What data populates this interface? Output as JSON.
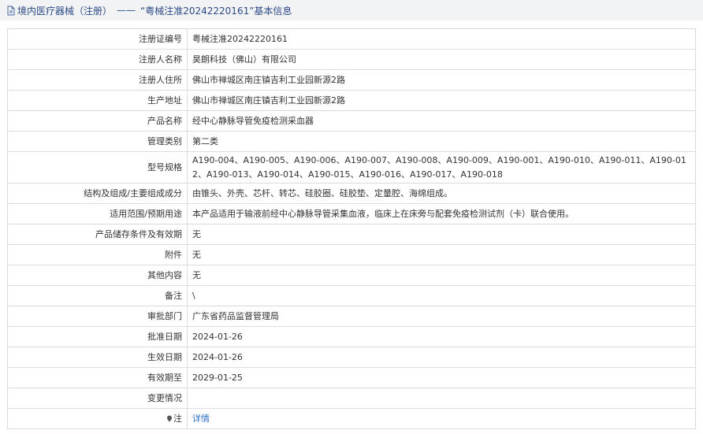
{
  "header": {
    "category": "境内医疗器械（注册）",
    "separator": "——",
    "record_title": "“粤械注准20242220161”基本信息"
  },
  "rows": [
    {
      "label": "注册证编号",
      "value": "粤械注准20242220161"
    },
    {
      "label": "注册人名称",
      "value": "昊朗科技（佛山）有限公司"
    },
    {
      "label": "注册人住所",
      "value": "佛山市禅城区南庄镇吉利工业园新源2路"
    },
    {
      "label": "生产地址",
      "value": "佛山市禅城区南庄镇吉利工业园新源2路"
    },
    {
      "label": "产品名称",
      "value": "经中心静脉导管免疫检测采血器"
    },
    {
      "label": "管理类别",
      "value": "第二类"
    },
    {
      "label": "型号规格",
      "value": "A190-004、A190-005、A190-006、A190-007、A190-008、A190-009、A190-001、A190-010、A190-011、A190-012、A190-013、A190-014、A190-015、A190-016、A190-017、A190-018"
    },
    {
      "label": "结构及组成/主要组成成分",
      "value": "由锥头、外壳、芯杆、转芯、硅胶圈、硅胶垫、定量腔、海绵组成。"
    },
    {
      "label": "适用范围/预期用途",
      "value": "本产品适用于输液前经中心静脉导管采集血液，临床上在床旁与配套免疫检测试剂（卡）联合使用。"
    },
    {
      "label": "产品储存条件及有效期",
      "value": "无"
    },
    {
      "label": "附件",
      "value": "无"
    },
    {
      "label": "其他内容",
      "value": "无"
    },
    {
      "label": "备注",
      "value": "\\"
    },
    {
      "label": "审批部门",
      "value": "广东省药品监督管理局"
    },
    {
      "label": "批准日期",
      "value": "2024-01-26"
    },
    {
      "label": "生效日期",
      "value": "2024-01-26"
    },
    {
      "label": "有效期至",
      "value": "2029-01-25"
    },
    {
      "label": "变更情况",
      "value": ""
    }
  ],
  "note_row": {
    "label": "注",
    "link_text": "详情",
    "icon": "location-pin-icon"
  },
  "colors": {
    "title_text": "#2c4a86",
    "title_bg": "#f2f3f5",
    "border": "#d8dde3",
    "link": "#2f6ec8"
  }
}
